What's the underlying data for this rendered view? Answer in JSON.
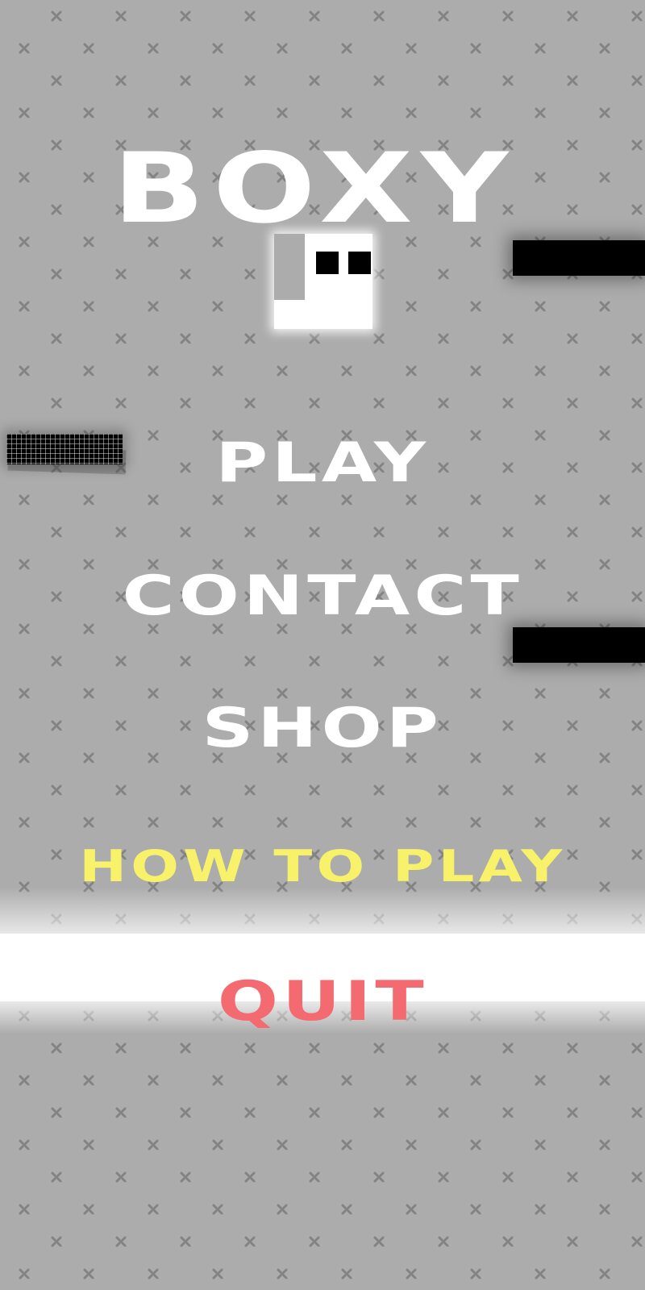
{
  "game": {
    "title": "BOXY"
  },
  "menu": {
    "items": [
      {
        "label": "PLAY",
        "color": "#ffffff"
      },
      {
        "label": "CONTACT",
        "color": "#ffffff"
      },
      {
        "label": "SHOP",
        "color": "#ffffff"
      },
      {
        "label": "HOW TO PLAY",
        "color": "#f7f26a"
      },
      {
        "label": "QUIT",
        "color": "#f36b70",
        "selected": true
      }
    ]
  },
  "theme": {
    "background": "#acacac",
    "pattern_mark": "x",
    "highlight_band": "#ffffff",
    "obstacle": "#000000"
  }
}
